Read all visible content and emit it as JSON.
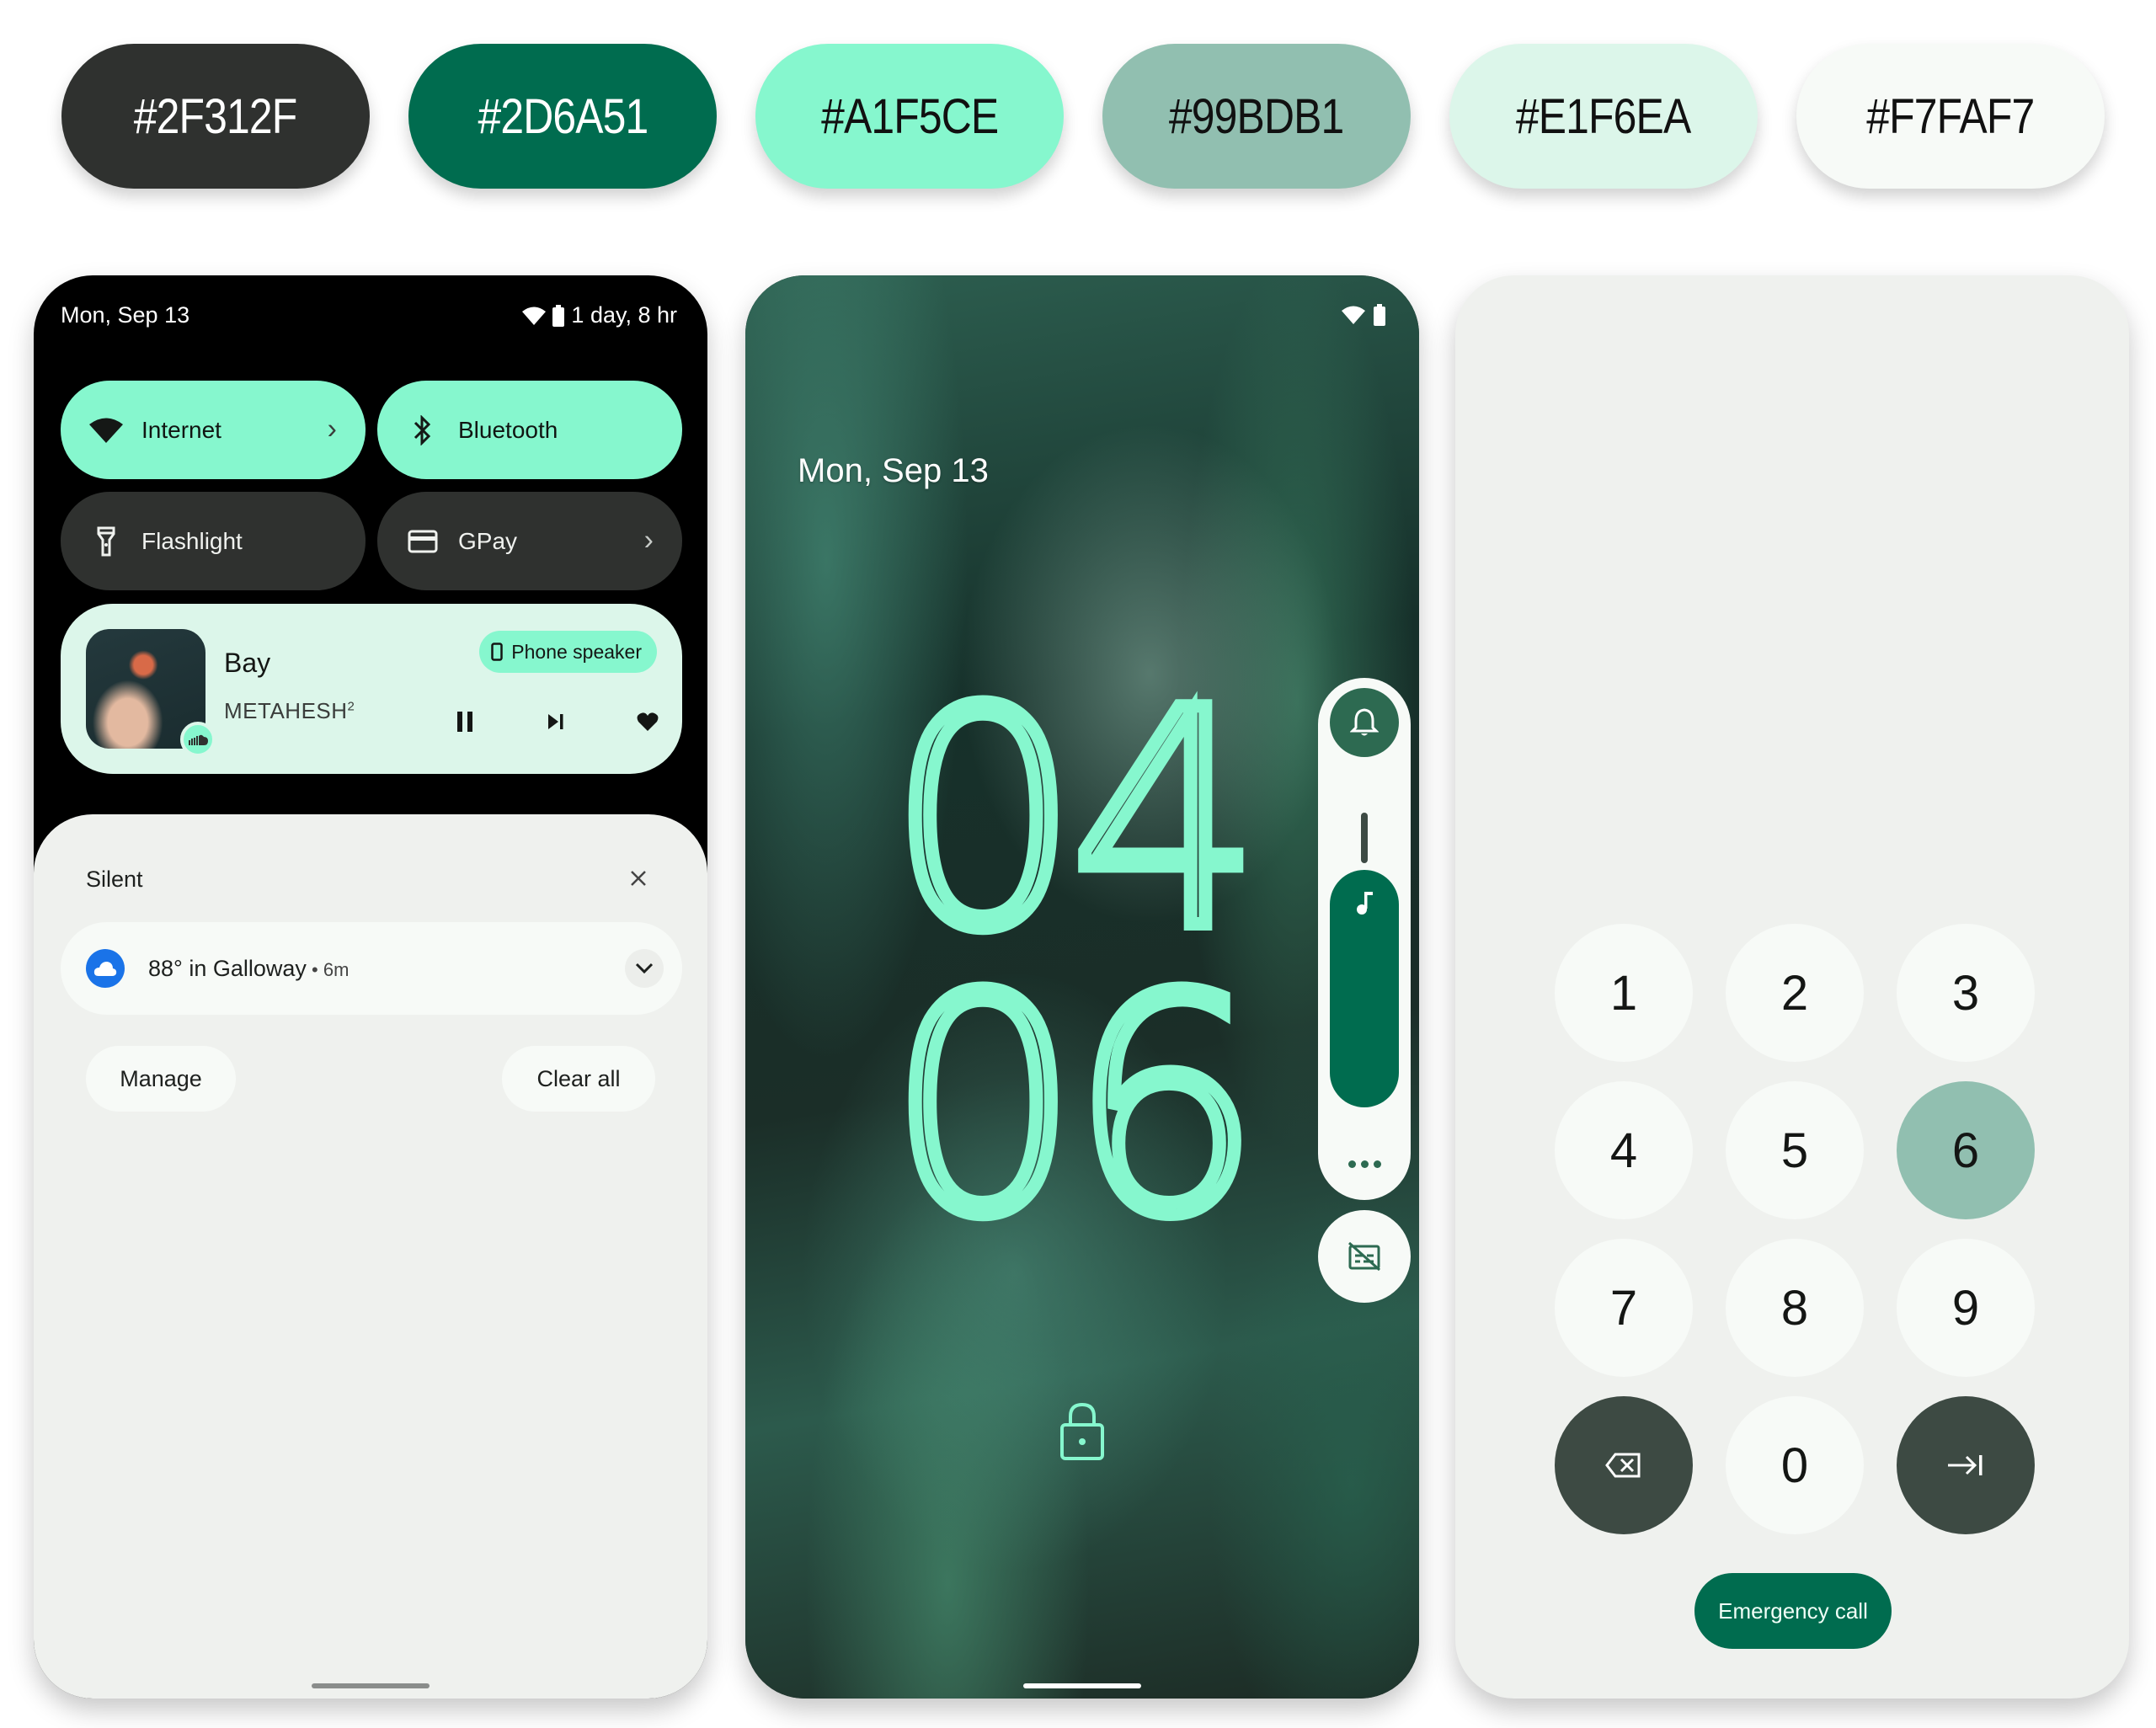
{
  "palette": [
    {
      "hex": "#2F312F",
      "color": "#2f312f",
      "text_color": "#ffffff"
    },
    {
      "hex": "#2D6A51",
      "color": "#006c4f",
      "text_color": "#ffffff"
    },
    {
      "hex": "#A1F5CE",
      "color": "#86f7ce",
      "text_color": "#111111"
    },
    {
      "hex": "#99BDB1",
      "color": "#91bfb0",
      "text_color": "#111111"
    },
    {
      "hex": "#E1F6EA",
      "color": "#dcf6ea",
      "text_color": "#111111"
    },
    {
      "hex": "#F7FAF7",
      "color": "#f7faf7",
      "text_color": "#111111"
    }
  ],
  "quick_settings": {
    "status_bar": {
      "date": "Mon, Sep 13",
      "battery_text": "1 day, 8 hr",
      "icons": [
        "wifi-icon",
        "battery-icon"
      ]
    },
    "tiles": [
      {
        "label": "Internet",
        "icon": "wifi-icon",
        "state": "on",
        "has_chevron": true
      },
      {
        "label": "Bluetooth",
        "icon": "bluetooth-icon",
        "state": "on",
        "has_chevron": false
      },
      {
        "label": "Flashlight",
        "icon": "flashlight-icon",
        "state": "off",
        "has_chevron": false
      },
      {
        "label": "GPay",
        "icon": "card-icon",
        "state": "off",
        "has_chevron": true
      }
    ],
    "media": {
      "title": "Bay",
      "artist": "METAHESH",
      "artist_superscript": "2",
      "output_label": "Phone speaker",
      "controls": [
        "pause-icon",
        "skip-next-icon",
        "heart-icon"
      ],
      "source_icon": "soundcloud-icon"
    },
    "notifications": {
      "section_label": "Silent",
      "items": [
        {
          "icon": "weather-cloud-icon",
          "text": "88° in Galloway",
          "separator": " • ",
          "age": "6m"
        }
      ],
      "manage_label": "Manage",
      "clear_all_label": "Clear all"
    }
  },
  "lock_screen": {
    "date": "Mon, Sep 13",
    "clock": {
      "hours": "04",
      "minutes": "06"
    },
    "volume": {
      "ringer_icon": "bell-icon",
      "stream_icon": "music-note-icon",
      "level_fraction": 0.72,
      "more_icon": "more-dots-icon"
    },
    "caption_icon": "captions-off-icon",
    "lock_icon": "lock-icon"
  },
  "pin_pad": {
    "keys": [
      "1",
      "2",
      "3",
      "4",
      "5",
      "6",
      "7",
      "8",
      "9",
      "backspace",
      "0",
      "enter"
    ],
    "pressed_key": "6",
    "emergency_label": "Emergency call"
  }
}
